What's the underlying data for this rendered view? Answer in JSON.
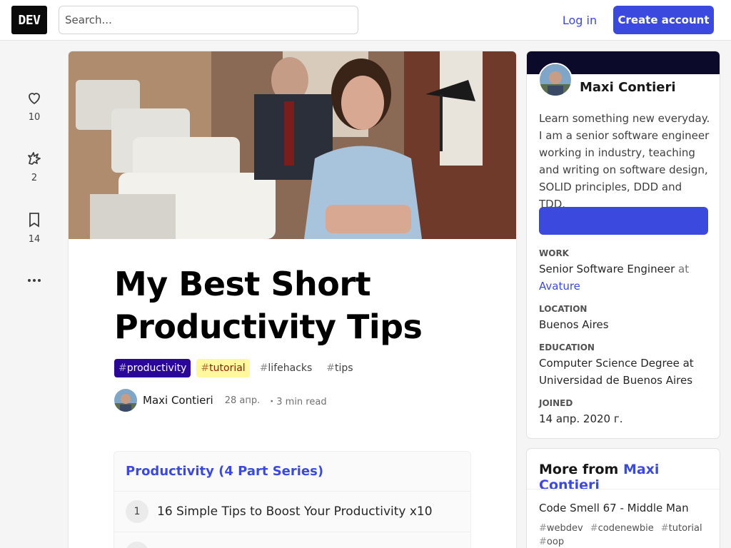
{
  "header": {
    "logo_text": "DEV",
    "search_placeholder": "Search...",
    "login_label": "Log in",
    "create_account_label": "Create account"
  },
  "reactions": [
    {
      "icon": "heart-icon",
      "count": "10"
    },
    {
      "icon": "unicorn-icon",
      "count": "2"
    },
    {
      "icon": "bookmark-icon",
      "count": "14"
    },
    {
      "icon": "more-icon",
      "count": ""
    }
  ],
  "article": {
    "title": "My Best Short Productivity Tips",
    "tags": [
      {
        "hash": "#",
        "name": "productivity"
      },
      {
        "hash": "#",
        "name": "tutorial"
      },
      {
        "hash": "#",
        "name": "lifehacks"
      },
      {
        "hash": "#",
        "name": "tips"
      }
    ],
    "author": "Maxi Contieri",
    "date": "28 апр.",
    "read_time": "・3 min read",
    "series": {
      "title": "Productivity (4 Part Series)",
      "items": [
        {
          "num": "1",
          "title": "16 Simple Tips to Boost Your Productivity x10"
        }
      ]
    }
  },
  "profile": {
    "name": "Maxi Contieri",
    "bio": "Learn something new everyday. I am a senior software engineer working in industry, teaching and writing on software design, SOLID principles, DDD and TDD.",
    "work_label": "Work",
    "work_title": "Senior Software Engineer",
    "work_at": "at",
    "work_company": "Avature",
    "location_label": "Location",
    "location": "Buenos Aires",
    "education_label": "Education",
    "education": "Computer Science Degree at Universidad de Buenos Aires",
    "joined_label": "Joined",
    "joined": "14 апр. 2020 г."
  },
  "more_from": {
    "prefix": "More from",
    "author": "Maxi Contieri",
    "item_title": "Code Smell 67 - Middle Man",
    "item_tags": [
      {
        "hash": "#",
        "name": "webdev"
      },
      {
        "hash": "#",
        "name": "codenewbie"
      },
      {
        "hash": "#",
        "name": "tutorial"
      },
      {
        "hash": "#",
        "name": "oop"
      }
    ]
  },
  "colors": {
    "accent": "#3b49df",
    "profile_band": "#0b0a2b",
    "tag_productivity_bg": "#2a0798",
    "tag_tutorial_bg": "#fff89e"
  }
}
